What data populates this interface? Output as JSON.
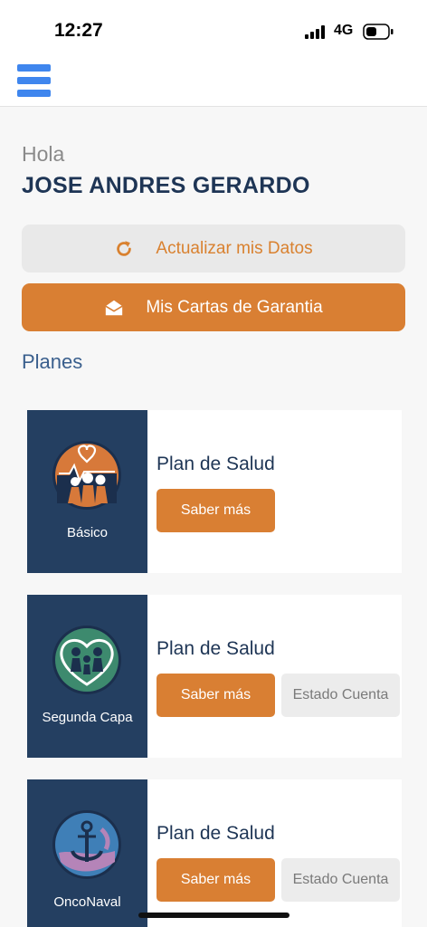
{
  "status_bar": {
    "time": "12:27",
    "network": "4G"
  },
  "header": {
    "menu_icon": "hamburger-menu-icon"
  },
  "greeting": {
    "hello": "Hola",
    "user_name": "JOSE ANDRES GERARDO"
  },
  "actions": {
    "update_label": "Actualizar mis Datos",
    "update_icon": "refresh-icon",
    "letters_label": "Mis Cartas de Garantia",
    "letters_icon": "envelope-open-icon"
  },
  "plans_section": {
    "title": "Planes"
  },
  "plans": [
    {
      "badge_label": "Básico",
      "title": "Plan de Salud",
      "more_label": "Saber más",
      "logo_icon": "health-family-logo-icon"
    },
    {
      "badge_label": "Segunda Capa",
      "title": "Plan de Salud",
      "more_label": "Saber más",
      "account_label": "Estado Cuenta",
      "logo_icon": "family-heart-logo-icon"
    },
    {
      "badge_label": "OncoNaval",
      "title": "Plan de Salud",
      "more_label": "Saber más",
      "account_label": "Estado Cuenta",
      "logo_icon": "anchor-ribbon-logo-icon"
    }
  ],
  "colors": {
    "accent_orange": "#d97f33",
    "navy": "#243f61",
    "menu_blue": "#3f86ee"
  }
}
